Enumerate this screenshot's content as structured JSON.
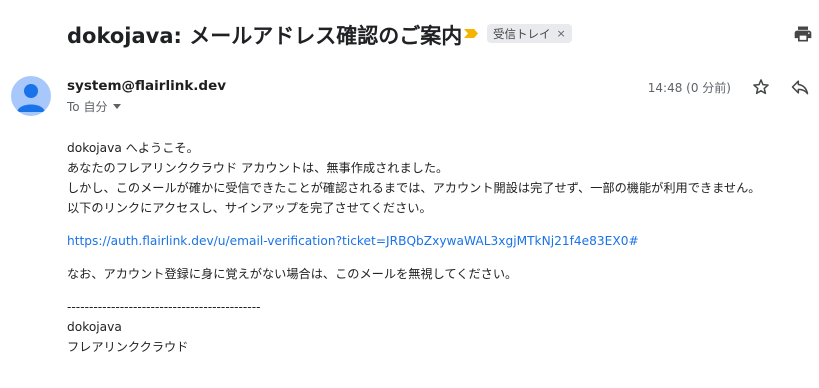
{
  "email": {
    "subject": "dokojava: メールアドレス確認のご案内",
    "label": "受信トレイ",
    "label_remove": "×",
    "sender": "system@flairlink.dev",
    "to": "To 自分",
    "time": "14:48 (0 分前)",
    "body": {
      "greeting": "dokojava へようこそ。",
      "line1": "あなたのフレアリンククラウド アカウントは、無事作成されました。",
      "line2": "しかし、このメールが確かに受信できたことが確認されるまでは、アカウント開設は完了せず、一部の機能が利用できません。",
      "line3": "以下のリンクにアクセスし、サインアップを完了させてください。",
      "link": "https://auth.flairlink.dev/u/email-verification?ticket=JRBQbZxywaWAL3xgjMTkNj21f4e83EX0#",
      "notice": "なお、アカウント登録に身に覚えがない場合は、このメールを無視してください。",
      "divider": "--------------------------------------------",
      "signature_name": "dokojava",
      "signature_company": "フレアリンククラウド"
    }
  },
  "icons": {
    "importance": "importance-marker-icon",
    "print": "print-icon",
    "avatar": "avatar-person-icon",
    "star": "star-icon",
    "reply": "reply-icon",
    "caret": "chevron-down-icon"
  },
  "colors": {
    "link": "#1a73e8",
    "importance": "#f4b400",
    "avatar_bg": "#a8c7fa",
    "avatar_fg": "#1a73e8",
    "chip_bg": "#e8eaed"
  }
}
